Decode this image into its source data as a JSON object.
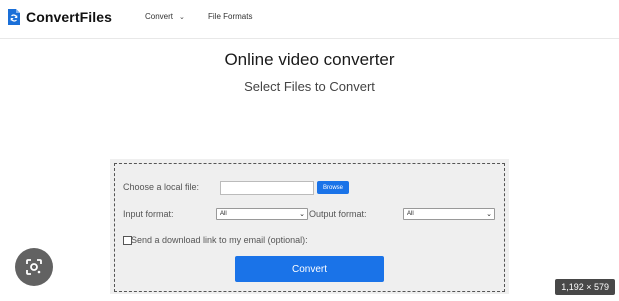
{
  "header": {
    "logo_text": "ConvertFiles",
    "logo_icon": "file-convert-icon",
    "nav_convert": "Convert",
    "nav_file_formats": "File Formats"
  },
  "main": {
    "title": "Online video converter",
    "subtitle": "Select Files to Convert"
  },
  "form": {
    "choose_label": "Choose a local file:",
    "browse_label": "Browse",
    "input_format_label": "Input format:",
    "input_format_value": "All",
    "output_format_label": "Output format:",
    "output_format_value": "All",
    "email_label": "Send a download link to my email (optional):",
    "convert_label": "Convert"
  },
  "overlay": {
    "image_size": "1,192 × 579",
    "lens_icon": "google-lens-icon"
  },
  "colors": {
    "accent": "#1a73e8",
    "panel_bg": "#efefef"
  }
}
